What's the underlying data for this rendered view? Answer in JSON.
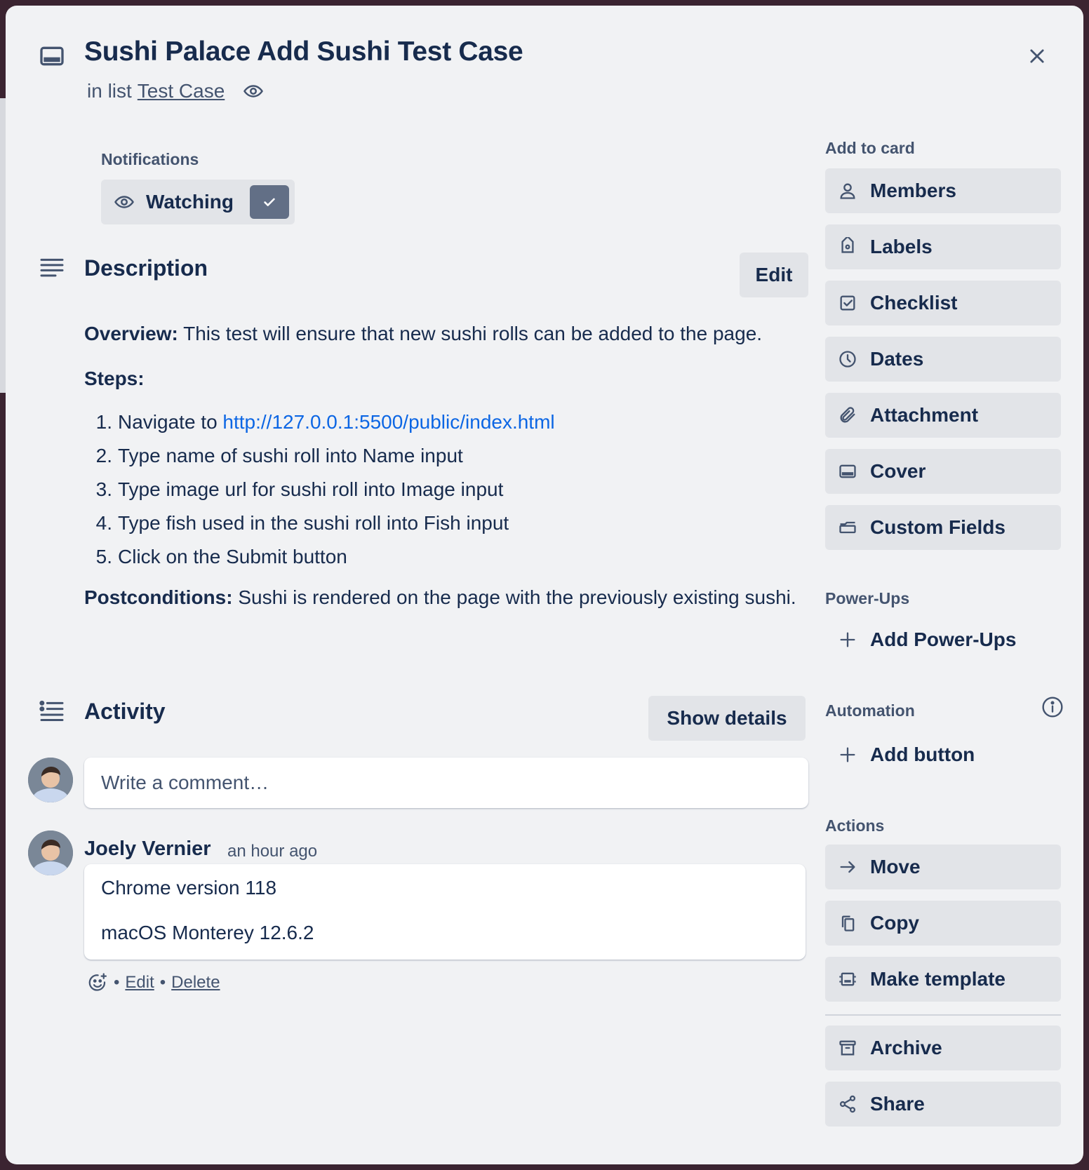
{
  "card": {
    "title": "Sushi Palace Add Sushi Test Case",
    "in_list_prefix": "in list",
    "list_name": "Test Case"
  },
  "notifications": {
    "label": "Notifications",
    "watch_label": "Watching"
  },
  "description": {
    "title": "Description",
    "edit_label": "Edit",
    "overview_label": "Overview:",
    "overview_text": " This test will ensure that new sushi rolls can be added to the page.",
    "steps_label": "Steps:",
    "steps": [
      {
        "num": "1.",
        "text": "Navigate to ",
        "link": "http://127.0.0.1:5500/public/index.html"
      },
      {
        "num": "2.",
        "text": "Type name of sushi roll into Name input"
      },
      {
        "num": "3.",
        "text": "Type image url for sushi roll into Image input"
      },
      {
        "num": "4.",
        "text": "Type fish used in the sushi roll into Fish input"
      },
      {
        "num": "5.",
        "text": "Click on the Submit button"
      }
    ],
    "postconditions_label": "Postconditions:",
    "postconditions_text": " Sushi is rendered on the page with the previously existing sushi."
  },
  "activity": {
    "title": "Activity",
    "show_details_label": "Show details",
    "comment_placeholder": "Write a comment…",
    "comments": [
      {
        "author": "Joely Vernier",
        "time": "an hour ago",
        "lines": [
          "Chrome version 118",
          "macOS Monterey 12.6.2"
        ],
        "edit_label": "Edit",
        "delete_label": "Delete"
      }
    ]
  },
  "sidebar": {
    "add_to_card_label": "Add to card",
    "add_to_card": [
      {
        "label": "Members",
        "icon": "person-icon"
      },
      {
        "label": "Labels",
        "icon": "tag-icon"
      },
      {
        "label": "Checklist",
        "icon": "checkbox-icon"
      },
      {
        "label": "Dates",
        "icon": "clock-icon"
      },
      {
        "label": "Attachment",
        "icon": "paperclip-icon"
      },
      {
        "label": "Cover",
        "icon": "cover-icon"
      },
      {
        "label": "Custom Fields",
        "icon": "custom-fields-icon"
      }
    ],
    "powerups_label": "Power-Ups",
    "add_powerups_label": "Add Power-Ups",
    "automation_label": "Automation",
    "add_button_label": "Add button",
    "actions_label": "Actions",
    "actions": [
      {
        "label": "Move",
        "icon": "arrow-right-icon"
      },
      {
        "label": "Copy",
        "icon": "copy-icon"
      },
      {
        "label": "Make template",
        "icon": "template-icon"
      }
    ],
    "more_actions": [
      {
        "label": "Archive",
        "icon": "archive-icon"
      },
      {
        "label": "Share",
        "icon": "share-icon"
      }
    ]
  }
}
